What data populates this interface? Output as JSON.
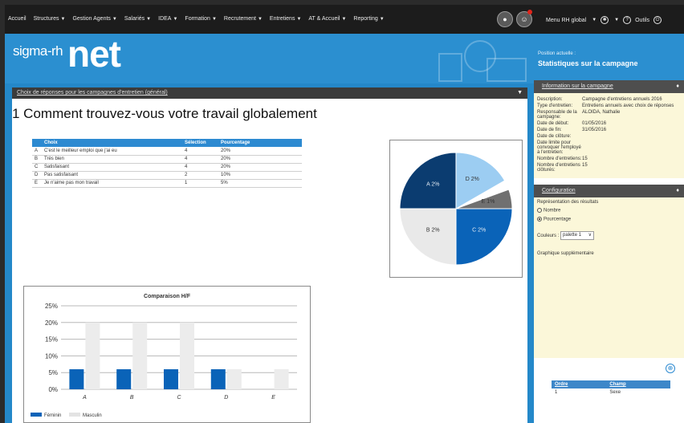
{
  "menu": {
    "items": [
      "Accueil",
      "Structures",
      "Gestion Agents",
      "Salariés",
      "IDEA",
      "Formation",
      "Recrutement",
      "Entretiens",
      "AT & Accueil",
      "Reporting"
    ],
    "right_label": "Menu RH global",
    "help_label": "Outils"
  },
  "header": {
    "logo_small": "sigma-rh",
    "logo_big": "net",
    "caption": "Position actuelle :",
    "title": "Statistiques sur la campagne"
  },
  "main": {
    "bar_title": "Choix de réponses pour les campagnes d'entretien (général)",
    "question": "1 Comment trouvez-vous votre travail globalement",
    "table_headers": [
      "",
      "Choix",
      "Sélection",
      "Pourcentage"
    ],
    "rows": [
      {
        "letter": "A",
        "choice": "C'est le meilleur emploi que j'ai eu",
        "count": "4",
        "pct": "20%"
      },
      {
        "letter": "B",
        "choice": "Très bien",
        "count": "4",
        "pct": "20%"
      },
      {
        "letter": "C",
        "choice": "Satisfaisant",
        "count": "4",
        "pct": "20%"
      },
      {
        "letter": "D",
        "choice": "Pas satisfaisant",
        "count": "2",
        "pct": "10%"
      },
      {
        "letter": "E",
        "choice": "Je n'aime pas mon travail",
        "count": "1",
        "pct": "5%"
      }
    ]
  },
  "colors": {
    "accent": "#2488c9",
    "bar_blue": "#0a63b8",
    "bar_grey": "#ececec",
    "side_bg": "#fbf7d9"
  },
  "chart_data": [
    {
      "type": "pie",
      "categories": [
        "A",
        "B",
        "C",
        "D",
        "E"
      ],
      "values": [
        20,
        20,
        20,
        10,
        5
      ],
      "labels": [
        "A 2%",
        "D 2%",
        "E 1%",
        "C 2%",
        "B 2%"
      ],
      "colors": [
        "#0b3c70",
        "#9ccdf2",
        "#707070",
        "#0a63b8",
        "#e9e9e9"
      ]
    },
    {
      "type": "bar",
      "title": "Comparaison H/F",
      "categories": [
        "A",
        "B",
        "C",
        "D",
        "E"
      ],
      "series": [
        {
          "name": "Féminin",
          "values": [
            6,
            6,
            6,
            6,
            0
          ]
        },
        {
          "name": "Masculin",
          "values": [
            20,
            20,
            20,
            6,
            6
          ]
        }
      ],
      "ylim": [
        0,
        25
      ],
      "yticks": [
        "0%",
        "5%",
        "10%",
        "15%",
        "20%",
        "25%"
      ],
      "grid": true,
      "legend": "bottom-left"
    }
  ],
  "sidebar": {
    "info_title": "Information sur la campagne",
    "info": [
      {
        "k": "Description:",
        "v": "Campagne d'entretiens annuels 2016"
      },
      {
        "k": "Type d'entretien:",
        "v": "Entretiens annuels avec choix de réponses"
      },
      {
        "k": "Responsable de la campagne:",
        "v": "ALOIDA, Nathalie"
      },
      {
        "k": "Date de début:",
        "v": "01/05/2016"
      },
      {
        "k": "Date de fin:",
        "v": "31/05/2016"
      },
      {
        "k": "Date de clôture:",
        "v": ""
      },
      {
        "k": "Date limite pour convoquer l'employé à l'entretien:",
        "v": ""
      },
      {
        "k": "Nombre d'entretiens:",
        "v": "15"
      },
      {
        "k": "Nombre d'entretiens clôturés:",
        "v": "15"
      }
    ],
    "config_title": "Configuration",
    "repr_label": "Représentation des résultats",
    "opt_nombre": "Nombre",
    "opt_pct": "Pourcentage",
    "colors_label": "Couleurs :",
    "palette_value": "palette 1",
    "extra_label": "Graphique supplémentaire",
    "order_headers": [
      "Ordre",
      "Champ"
    ],
    "order_rows": [
      {
        "ordre": "1",
        "champ": "Sexe"
      }
    ]
  }
}
